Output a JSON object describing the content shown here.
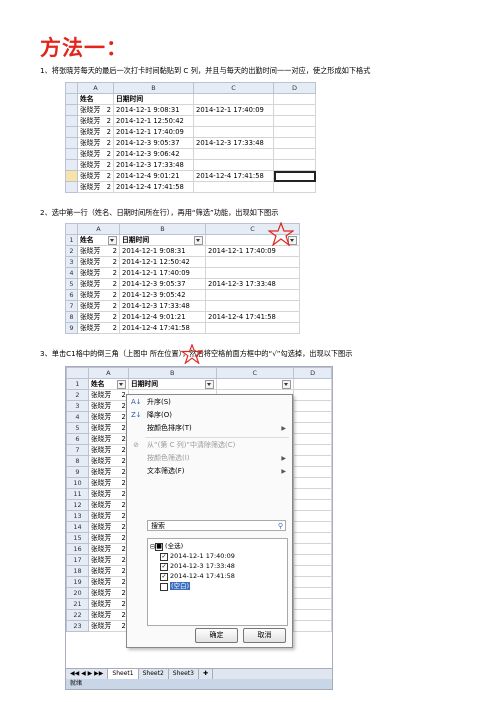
{
  "title": "方法一：",
  "steps": {
    "s1": "1、将张晓芳每天的最后一次打卡时间黏贴到 C 列，并且与每天的出勤时间一一对应，使之形成如下格式",
    "s2": "2、选中第一行（姓名、日期时间所在行），再用“筛选”功能，出现如下图示",
    "s3": "3、单击C1格中的倒三角（上图中 所在位置），然后将空格前面方框中的“√”勾选掉，出现以下图示"
  },
  "sheet1": {
    "col_headers": [
      "A",
      "B",
      "C",
      "D"
    ],
    "header_row": [
      "姓名",
      "日期时间",
      "",
      ""
    ],
    "rows": [
      [
        "张晓芳",
        "2",
        "2014-12-1 9:08:31",
        "2014-12-1 17:40:09"
      ],
      [
        "张晓芳",
        "2",
        "2014-12-1 12:50:42",
        ""
      ],
      [
        "张晓芳",
        "2",
        "2014-12-1 17:40:09",
        ""
      ],
      [
        "张晓芳",
        "2",
        "2014-12-3 9:05:37",
        "2014-12-3 17:33:48"
      ],
      [
        "张晓芳",
        "2",
        "2014-12-3 9:06:42",
        ""
      ],
      [
        "张晓芳",
        "2",
        "2014-12-3 17:33:48",
        ""
      ],
      [
        "张晓芳",
        "2",
        "2014-12-4 9:01:21",
        "2014-12-4 17:41:58"
      ],
      [
        "张晓芳",
        "2",
        "2014-12-4 17:41:58",
        ""
      ]
    ]
  },
  "sheet2": {
    "col_headers": [
      "A",
      "B",
      "C"
    ],
    "header_row": [
      "姓名",
      "日期时间",
      ""
    ],
    "rows": [
      [
        "张晓芳",
        "2",
        "2014-12-1 9:08:31",
        "2014-12-1 17:40:09"
      ],
      [
        "张晓芳",
        "2",
        "2014-12-1 12:50:42",
        ""
      ],
      [
        "张晓芳",
        "2",
        "2014-12-1 17:40:09",
        ""
      ],
      [
        "张晓芳",
        "2",
        "2014-12-3 9:05:37",
        "2014-12-3 17:33:48"
      ],
      [
        "张晓芳",
        "2",
        "2014-12-3 9:05:42",
        ""
      ],
      [
        "张晓芳",
        "2",
        "2014-12-3 17:33:48",
        ""
      ],
      [
        "张晓芳",
        "2",
        "2014-12-4 9:01:21",
        "2014-12-4 17:41:58"
      ],
      [
        "张晓芳",
        "2",
        "2014-12-4 17:41:58",
        ""
      ]
    ]
  },
  "sheet3": {
    "col_headers": [
      "A",
      "B",
      "C",
      "D"
    ],
    "header_row": [
      "姓名",
      "日期时间",
      "",
      ""
    ],
    "name": "张晓芳",
    "num": "2",
    "menu": {
      "sort_asc": "升序(S)",
      "sort_desc": "降序(O)",
      "sort_color": "按颜色排序(T)",
      "clear_filter": "从“(第 C 列)”中清除筛选(C)",
      "filter_color": "按颜色筛选(I)",
      "text_filter": "文本筛选(F)",
      "search_placeholder": "搜索",
      "items": [
        "(全选)",
        "2014-12-1 17:40:09",
        "2014-12-3 17:33:48",
        "2014-12-4 17:41:58",
        "(空白)"
      ],
      "ok": "确定",
      "cancel": "取消"
    },
    "tabs": [
      "Sheet1",
      "Sheet2",
      "Sheet3"
    ],
    "status": "就绪"
  }
}
